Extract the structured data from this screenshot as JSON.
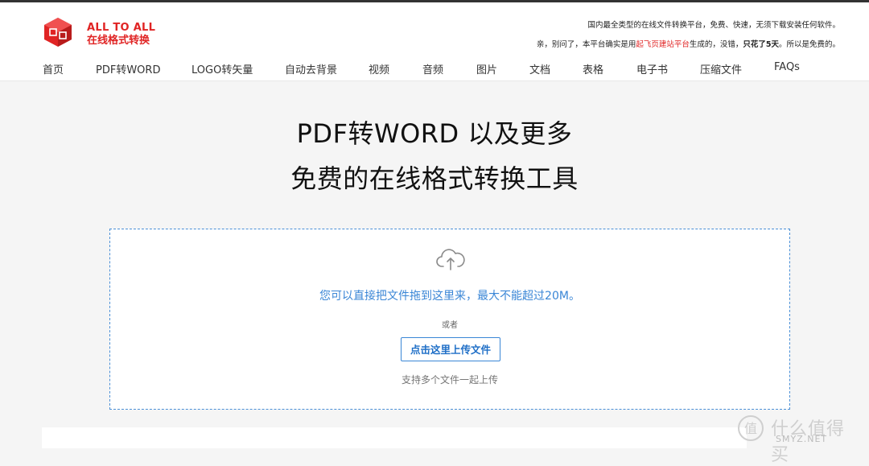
{
  "logo": {
    "en": "ALL TO ALL",
    "cn": "在线格式转换"
  },
  "tagline": {
    "line1": "国内最全类型的在线文件转换平台，免费、快速，无须下载安装任何软件。",
    "line2_a": "亲，别问了，本平台确实是用",
    "line2_link": "起飞页建站平台",
    "line2_b": "生成的，没错，",
    "line2_bold": "只花了5天",
    "line2_c": "。所以是免费的。"
  },
  "nav": [
    "首页",
    "PDF转WORD",
    "LOGO转矢量",
    "自动去背景",
    "视频",
    "音频",
    "图片",
    "文档",
    "表格",
    "电子书",
    "压缩文件",
    "FAQs"
  ],
  "hero": {
    "title_line1": "PDF转WORD 以及更多",
    "title_line2": "免费的在线格式转换工具"
  },
  "upload": {
    "drop_text": "您可以直接把文件拖到这里来，最大不能超过20M。",
    "or_text": "或者",
    "button_label": "点击这里上传文件",
    "multi_text": "支持多个文件一起上传"
  },
  "watermark": {
    "cn": "什么值得买",
    "en": "SMYZ.NET"
  },
  "colors": {
    "brand": "#e02424",
    "accent": "#3a86d6"
  }
}
